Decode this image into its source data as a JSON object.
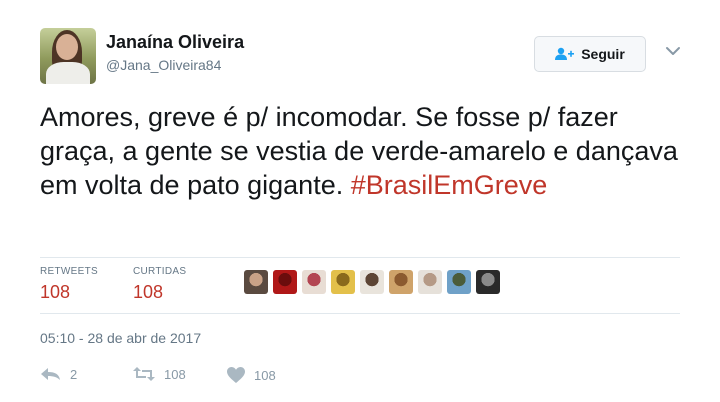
{
  "tweet": {
    "author_name": "Janaína Oliveira",
    "author_handle": "@Jana_Oliveira84",
    "text": "Amores, greve é p/ incomodar. Se fosse p/ fazer graça, a gente se vestia de verde-amarelo e dançava em volta de pato gigante.",
    "hashtag": "#BrasilEmGreve",
    "timestamp": "05:10 - 28 de abr de 2017"
  },
  "follow": {
    "label": "Seguir",
    "icon": "add-user-icon"
  },
  "stats": {
    "retweets_label": "RETWEETS",
    "retweets_value": "108",
    "likes_label": "CURTIDAS",
    "likes_value": "108"
  },
  "liker_avatars": [
    {
      "name": "liker-avatar-1",
      "color_a": "#5a4a40",
      "color_b": "#c9a287"
    },
    {
      "name": "liker-avatar-2",
      "color_a": "#b01818",
      "color_b": "#6b0d0d"
    },
    {
      "name": "liker-avatar-3",
      "color_a": "#e8ddd4",
      "color_b": "#b34552"
    },
    {
      "name": "liker-avatar-4",
      "color_a": "#e3c04a",
      "color_b": "#8a6a1c"
    },
    {
      "name": "liker-avatar-5",
      "color_a": "#e9e4dc",
      "color_b": "#5d4535"
    },
    {
      "name": "liker-avatar-6",
      "color_a": "#cfa36a",
      "color_b": "#8c5a2f"
    },
    {
      "name": "liker-avatar-7",
      "color_a": "#e6e1da",
      "color_b": "#b59a86"
    },
    {
      "name": "liker-avatar-8",
      "color_a": "#6fa1c8",
      "color_b": "#4b5c3a"
    },
    {
      "name": "liker-avatar-9",
      "color_a": "#2a2a2a",
      "color_b": "#8a8a8a"
    }
  ],
  "actions": {
    "reply_count": "2",
    "retweet_count": "108",
    "like_count": "108"
  },
  "colors": {
    "hashtag": "#c0362a",
    "muted": "#657786",
    "icon": "#8899a6"
  }
}
